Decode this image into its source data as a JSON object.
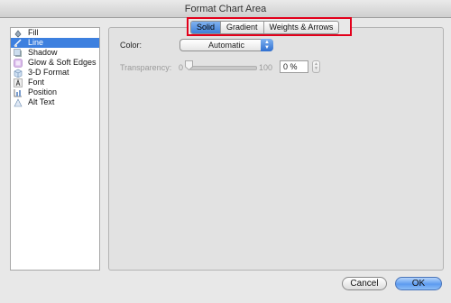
{
  "window": {
    "title": "Format Chart Area"
  },
  "sidebar": {
    "items": [
      {
        "label": "Fill",
        "icon": "paint-bucket-icon",
        "selected": false
      },
      {
        "label": "Line",
        "icon": "line-brush-icon",
        "selected": true
      },
      {
        "label": "Shadow",
        "icon": "shadow-icon",
        "selected": false
      },
      {
        "label": "Glow & Soft Edges",
        "icon": "glow-icon",
        "selected": false
      },
      {
        "label": "3-D Format",
        "icon": "cube-icon",
        "selected": false
      },
      {
        "label": "Font",
        "icon": "font-icon",
        "selected": false
      },
      {
        "label": "Position",
        "icon": "position-icon",
        "selected": false
      },
      {
        "label": "Alt Text",
        "icon": "alt-text-icon",
        "selected": false
      }
    ]
  },
  "tabs": {
    "items": [
      {
        "label": "Solid",
        "active": true
      },
      {
        "label": "Gradient",
        "active": false
      },
      {
        "label": "Weights & Arrows",
        "active": false
      }
    ]
  },
  "line": {
    "color_label": "Color:",
    "color_value": "Automatic",
    "transparency_label": "Transparency:",
    "slider_min": "0",
    "slider_max": "100",
    "transparency_value": "0 %",
    "transparency_level": 0
  },
  "buttons": {
    "cancel": "Cancel",
    "ok": "OK"
  },
  "colors": {
    "selection": "#3d80df",
    "highlight_border": "#e3001b",
    "accent": "#5d9bf0"
  }
}
